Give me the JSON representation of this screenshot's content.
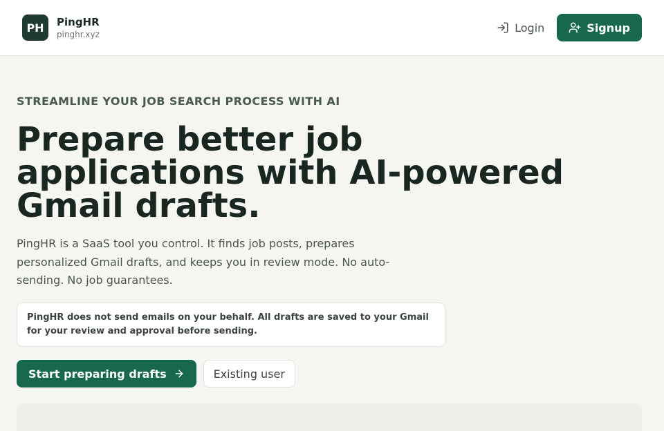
{
  "brand": {
    "logo_text": "PH",
    "name": "PingHR",
    "domain": "pinghr.xyz"
  },
  "nav": {
    "login_label": "Login",
    "login_icon": "login-arrow-icon",
    "signup_label": "Signup",
    "signup_icon": "user-plus-icon"
  },
  "hero": {
    "eyebrow": "STREAMLINE YOUR JOB SEARCH PROCESS WITH AI",
    "title": "Prepare better job applications with AI-powered Gmail drafts.",
    "lead": "PingHR is a SaaS tool you control. It finds job posts, prepares personalized Gmail drafts, and keeps you in review mode. No auto-sending. No job guarantees.",
    "notice": "PingHR does not send emails on your behalf. All drafts are saved to your Gmail for your review and approval before sending.",
    "primary_cta": "Start preparing drafts",
    "primary_cta_icon": "arrow-right-icon",
    "secondary_cta": "Existing user"
  },
  "colors": {
    "accent": "#17684f",
    "logo_bg": "#1f3a2e",
    "page_bg": "#f5f5f2"
  }
}
